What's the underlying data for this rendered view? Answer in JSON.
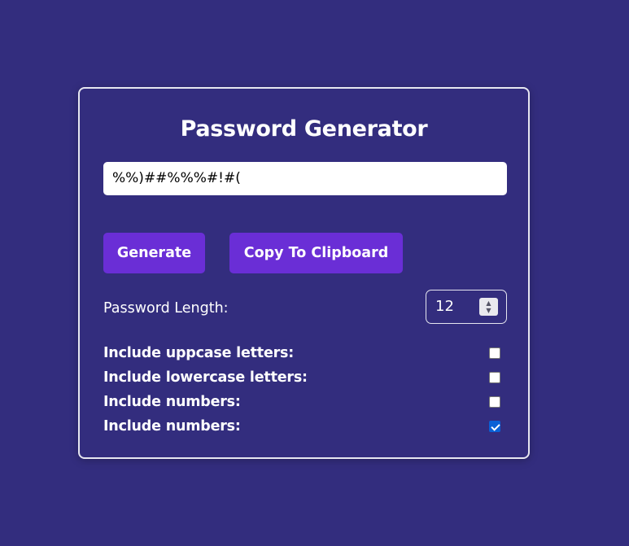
{
  "app": {
    "title": "Password Generator"
  },
  "output": {
    "value": "%%)##%%%#!#("
  },
  "buttons": {
    "generate_label": "Generate",
    "copy_label": "Copy To Clipboard"
  },
  "length": {
    "label": "Password Length:",
    "value": "12"
  },
  "options": [
    {
      "label": "Include uppcase letters:",
      "checked": false
    },
    {
      "label": "Include lowercase letters:",
      "checked": false
    },
    {
      "label": "Include numbers:",
      "checked": false
    },
    {
      "label": "Include numbers:",
      "checked": true
    }
  ],
  "colors": {
    "background": "#332d7e",
    "button": "#6a2ed6",
    "checkbox_checked": "#0a61d6"
  }
}
